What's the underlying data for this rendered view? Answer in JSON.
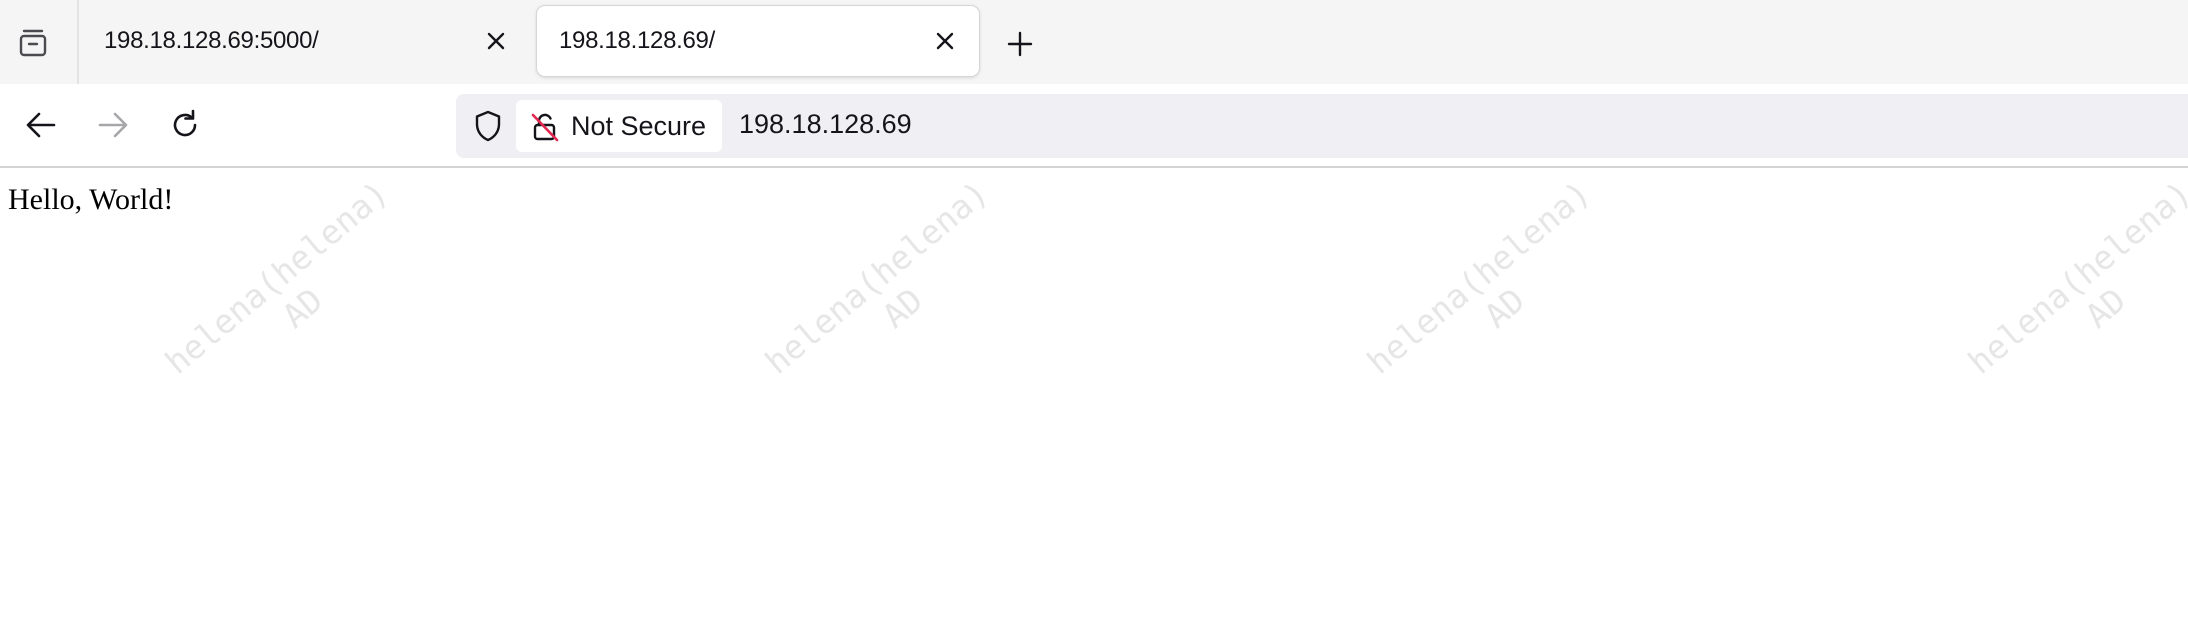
{
  "tabs": [
    {
      "title": "198.18.128.69:5000/",
      "active": false
    },
    {
      "title": "198.18.128.69/",
      "active": true
    }
  ],
  "toolbar": {
    "tab_list_icon": "tab-list-icon",
    "new_tab_icon": "plus-icon",
    "close_icon": "close-icon"
  },
  "navigation": {
    "back_icon": "back-arrow-icon",
    "forward_icon": "forward-arrow-icon",
    "forward_enabled": false,
    "reload_icon": "reload-icon"
  },
  "urlbar": {
    "tracking_icon": "shield-icon",
    "security_icon": "insecure-lock-icon",
    "security_label": "Not Secure",
    "url": "198.18.128.69"
  },
  "page": {
    "body_text": "Hello, World!",
    "watermark": {
      "line1": "helena(helena)",
      "line2": "AD"
    }
  },
  "colors": {
    "tabstrip_bg": "#f5f5f5",
    "urlbar_bg": "#f0f0f4",
    "insecure_slash": "#e22850",
    "watermark": "#e6e6e6"
  }
}
